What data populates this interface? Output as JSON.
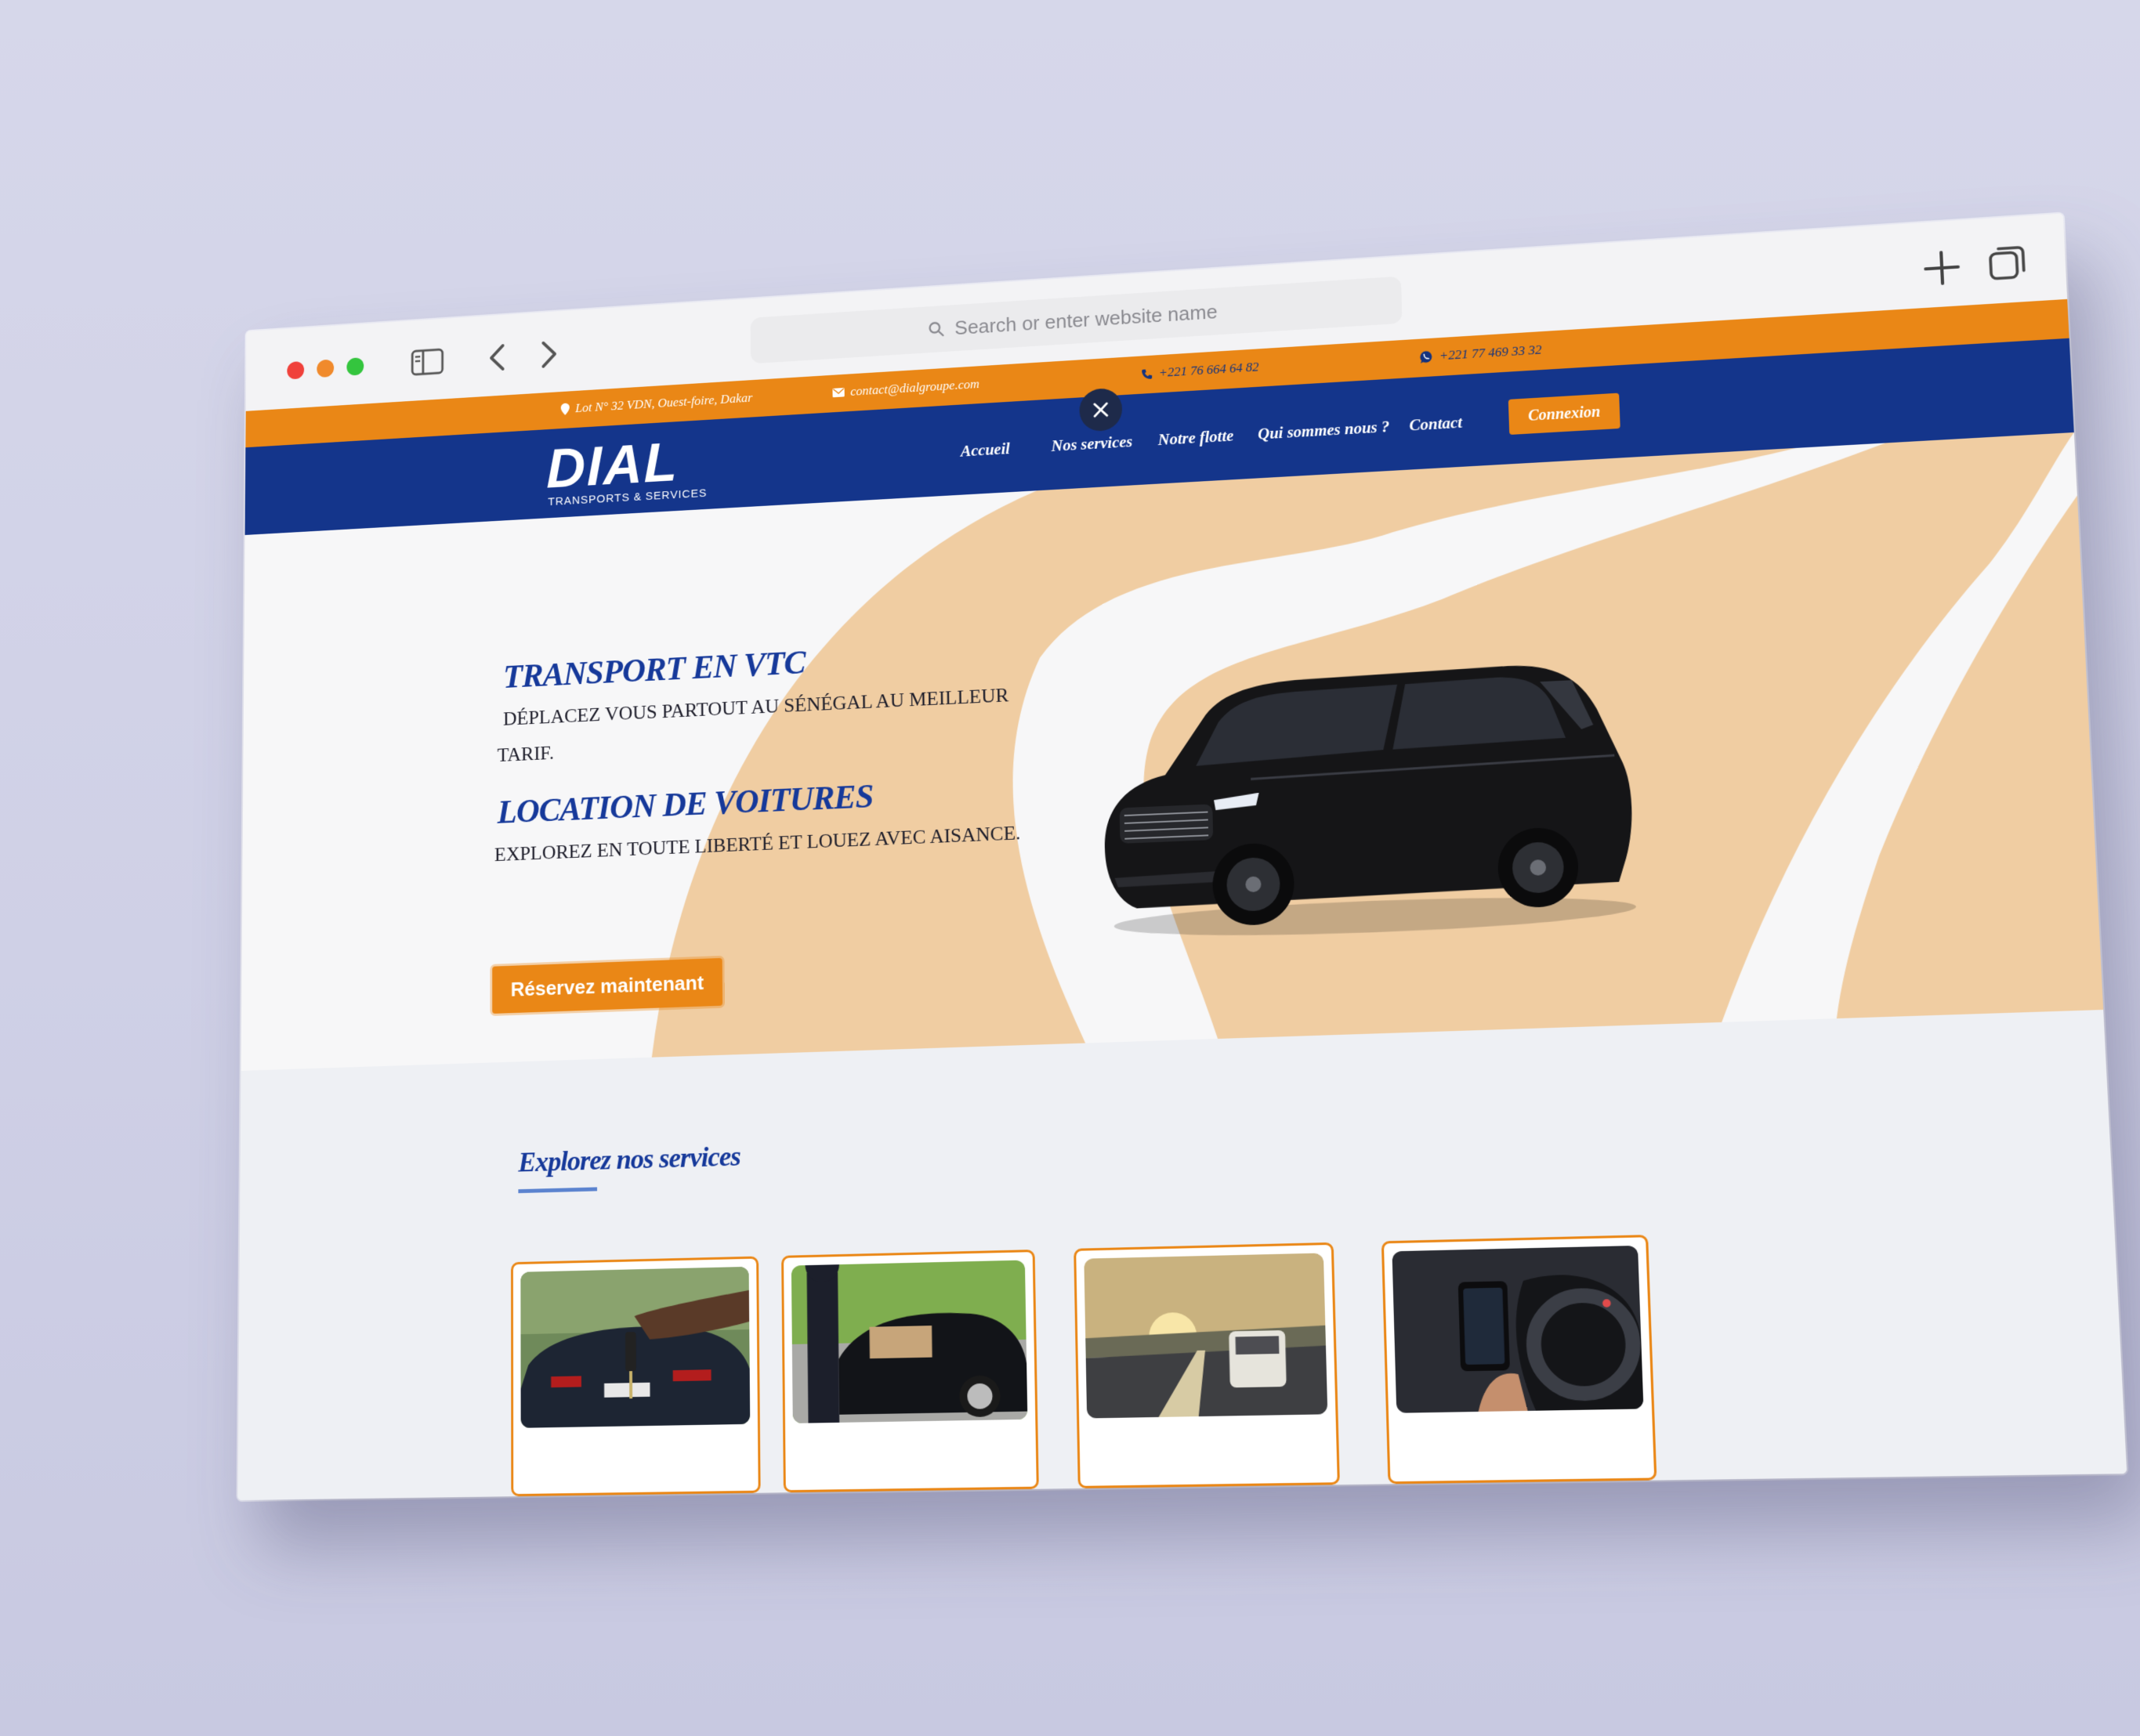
{
  "browser": {
    "address_placeholder": "Search or enter website name"
  },
  "topbar": {
    "address": "Lot N° 32 VDN, Ouest-foire, Dakar",
    "email": "contact@dialgroupe.com",
    "phone": "+221 76 664 64 82",
    "whatsapp": "+221 77 469 33 32"
  },
  "header": {
    "logo_word": "DIAL",
    "logo_sub": "TRANSPORTS & SERVICES",
    "nav": [
      "Accueil",
      "Nos services",
      "Notre flotte",
      "Qui sommes nous ?",
      "Contact"
    ],
    "login_label": "Connexion"
  },
  "hero": {
    "title_1": "TRANSPORT EN VTC",
    "text_1a": "DÉPLACEZ VOUS PARTOUT AU SÉNÉGAL AU MEILLEUR",
    "text_1b": "TARIF.",
    "title_2": "LOCATION DE VOITURES",
    "text_2": "EXPLOREZ EN TOUTE LIBERTÉ ET LOUEZ AVEC AISANCE.",
    "cta_label": "Réservez maintenant"
  },
  "services": {
    "title": "Explorez nos services"
  },
  "colors": {
    "orange": "#ea8716",
    "navy": "#14358b",
    "title_blue": "#16399a",
    "peach": "#f0cda2"
  }
}
